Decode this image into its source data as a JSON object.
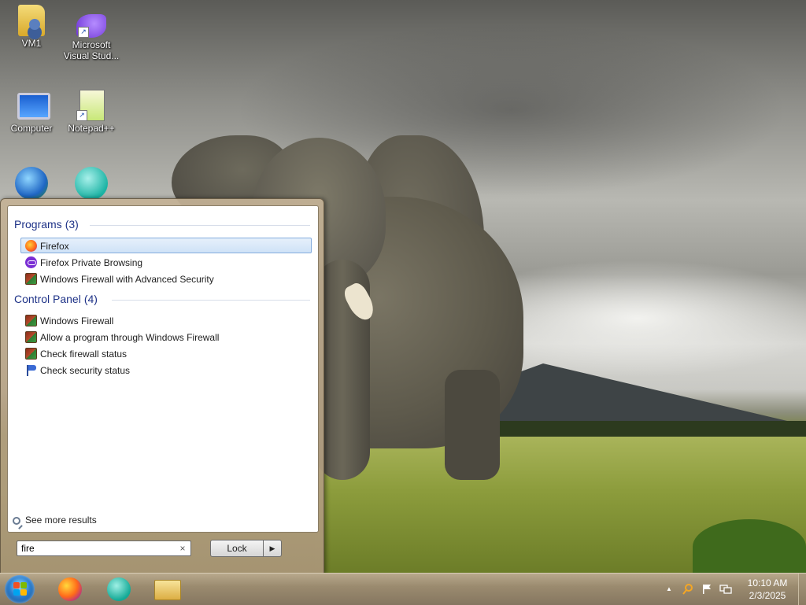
{
  "desktop": {
    "icons": [
      {
        "label": "VM1"
      },
      {
        "label": "Microsoft Visual Stud..."
      },
      {
        "label": "Computer"
      },
      {
        "label": "Notepad++"
      },
      {
        "label": ""
      },
      {
        "label": ""
      }
    ]
  },
  "start_menu": {
    "groups": [
      {
        "title": "Programs",
        "count": "(3)",
        "items": [
          {
            "label": "Firefox",
            "icon": "firefox-icon"
          },
          {
            "label": "Firefox Private Browsing",
            "icon": "firefox-private-icon"
          },
          {
            "label": "Windows Firewall with Advanced Security",
            "icon": "firewall-icon"
          }
        ]
      },
      {
        "title": "Control Panel",
        "count": "(4)",
        "items": [
          {
            "label": "Windows Firewall",
            "icon": "firewall-icon"
          },
          {
            "label": "Allow a program through Windows Firewall",
            "icon": "firewall-icon"
          },
          {
            "label": "Check firewall status",
            "icon": "firewall-icon"
          },
          {
            "label": "Check security status",
            "icon": "action-center-flag-icon"
          }
        ]
      }
    ],
    "see_more": "See more results",
    "search": {
      "value": "fire",
      "clear_glyph": "×"
    },
    "lock_button": "Lock",
    "lock_arrow": "▶"
  },
  "taskbar": {
    "apps": [
      "firefox-icon",
      "teal-app-icon",
      "file-explorer-icon"
    ],
    "tray": {
      "time": "10:10 AM",
      "date": "2/3/2025",
      "show_hidden": "▲"
    }
  }
}
